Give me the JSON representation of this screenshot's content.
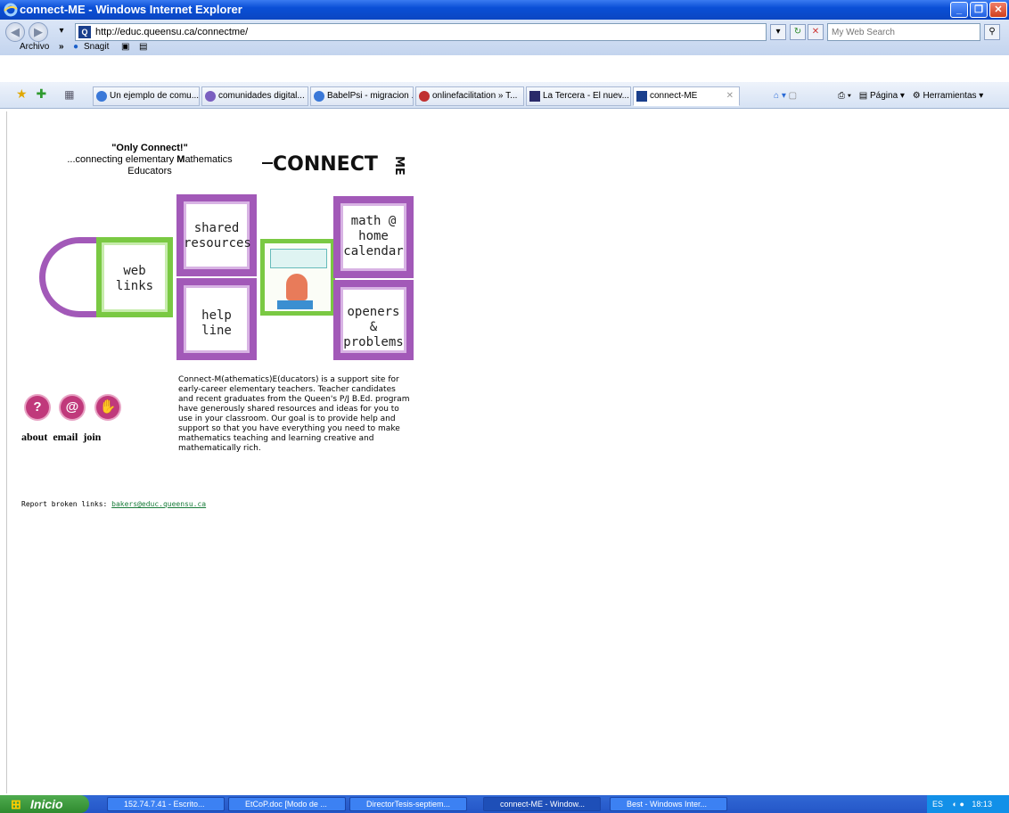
{
  "window": {
    "title": "connect-ME - Windows Internet Explorer"
  },
  "address": {
    "url": "http://educ.queensu.ca/connectme/",
    "search_placeholder": "My Web Search"
  },
  "menu": {
    "archivo": "Archivo",
    "more": "»",
    "snagit": "Snagit"
  },
  "tabs": [
    {
      "label": "Un ejemplo de comu..."
    },
    {
      "label": "comunidades digital..."
    },
    {
      "label": "BabelPsi - migracion ..."
    },
    {
      "label": "onlinefacilitation » T..."
    },
    {
      "label": "La Tercera - El nuev..."
    },
    {
      "label": "connect-ME"
    }
  ],
  "tools": {
    "page": "Página",
    "tools": "Herramientas"
  },
  "page": {
    "only_connect": "\"Only Connect!\"",
    "tagline_1": "...connecting elementary ",
    "tagline_m": "M",
    "tagline_2": "athematics",
    "tagline_3": "Educators",
    "logo_text": "CONNECT",
    "logo_me": "ME",
    "tiles": {
      "shared_1": "shared",
      "shared_2": "resources",
      "math_1": "math @",
      "math_2": "home",
      "math_3": "calendar",
      "web_1": "web",
      "web_2": "links",
      "help_1": "help",
      "help_2": "line",
      "openers_1": "openers &",
      "openers_2": "problems"
    },
    "circle_labels": {
      "about": "about",
      "email": "email",
      "join": "join"
    },
    "description": "Connect-M(athematics)E(ducators) is a support site for early-career elementary teachers. Teacher candidates and recent graduates from the Queen's P/J B.Ed. program have generously shared resources and ideas for you to use in your classroom. Our goal is to provide help and support so that you have everything you need to make mathematics teaching and learning creative and mathematically rich.",
    "report_label": "Report broken links: ",
    "report_email": "bakers@educ.queensu.ca"
  },
  "taskbar": {
    "start": "Inicio",
    "items": [
      {
        "label": "152.74.7.41 - Escrito..."
      },
      {
        "label": "EtCoP.doc [Modo de ..."
      },
      {
        "label": "DirectorTesis-septiem..."
      },
      {
        "label": "connect-ME - Window..."
      },
      {
        "label": "Best - Windows Inter..."
      }
    ],
    "tray_lang": "ES",
    "clock": "18:13"
  },
  "colors": {
    "purple": "#a259b8",
    "green": "#7ac943",
    "circle": "#c0397b",
    "titlebar": "#0a4fd6"
  }
}
